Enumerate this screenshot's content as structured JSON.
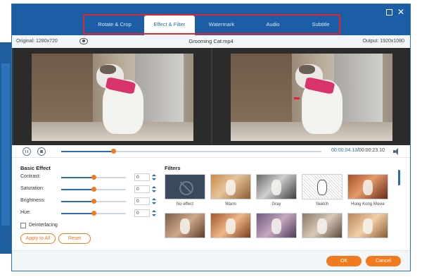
{
  "window": {
    "maximize_icon": "maximize-icon",
    "close_icon": "close-icon",
    "close_glyph": "✕"
  },
  "tabs": [
    {
      "label": "Rotate & Crop",
      "active": false
    },
    {
      "label": "Effect & Filter",
      "active": true
    },
    {
      "label": "Watermark",
      "active": false
    },
    {
      "label": "Audio",
      "active": false
    },
    {
      "label": "Subtitle",
      "active": false
    }
  ],
  "info": {
    "original": "Original: 1280x720",
    "filename": "Grooming Cat.mp4",
    "output": "Output: 1920x1080"
  },
  "playback": {
    "current_time": "00:00:04.13",
    "total_time": "/00:00:23.10",
    "progress": 0.2
  },
  "basic_effect": {
    "title": "Basic Effect",
    "controls": [
      {
        "label": "Contrast:",
        "value": "0",
        "level": 0.5
      },
      {
        "label": "Saturation:",
        "value": "0",
        "level": 0.5
      },
      {
        "label": "Brightness:",
        "value": "0",
        "level": 0.5
      },
      {
        "label": "Hue:",
        "value": "0",
        "level": 0.5
      }
    ],
    "deinterlacing_label": "Deinterlacing",
    "apply_label": "Apply to All",
    "reset_label": "Reset"
  },
  "filters": {
    "title": "Filters",
    "items": [
      {
        "label": "No effect"
      },
      {
        "label": "Warm"
      },
      {
        "label": "Gray"
      },
      {
        "label": "Sketch"
      },
      {
        "label": "Hong Kong Movie"
      }
    ]
  },
  "footer": {
    "ok_label": "OK",
    "cancel_label": "Cancel"
  },
  "colors": {
    "accent": "#1c5ea6",
    "highlight": "#e0252c",
    "orange": "#f07b1e"
  }
}
